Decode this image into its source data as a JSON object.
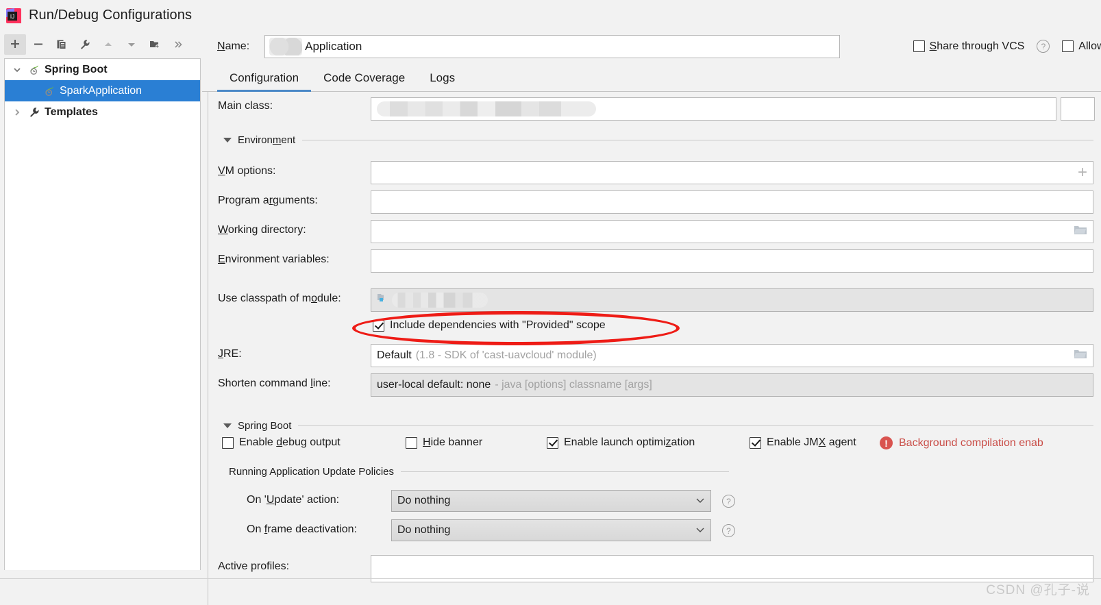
{
  "window": {
    "title": "Run/Debug Configurations",
    "app_icon": "intellij-idea-icon"
  },
  "toolbar": {
    "buttons": [
      {
        "name": "add-configuration-button",
        "icon": "plus-icon",
        "label": "+",
        "active": true
      },
      {
        "name": "remove-configuration-button",
        "icon": "minus-icon",
        "label": "−",
        "active": false
      },
      {
        "name": "copy-configuration-button",
        "icon": "copy-icon",
        "label": "",
        "active": false
      },
      {
        "name": "edit-templates-button",
        "icon": "wrench-icon",
        "label": "",
        "active": false
      },
      {
        "name": "move-up-button",
        "icon": "triangle-up-icon",
        "label": "",
        "active": false
      },
      {
        "name": "move-down-button",
        "icon": "triangle-down-icon",
        "label": "",
        "active": false
      },
      {
        "name": "new-folder-button",
        "icon": "folder-plus-icon",
        "label": "",
        "active": false
      },
      {
        "name": "more-options-button",
        "icon": "chevron-double-right-icon",
        "label": "»",
        "active": false
      }
    ]
  },
  "tree": {
    "items": [
      {
        "label": "Spring Boot",
        "twisty": "chevron-down-icon",
        "icon": "spring-boot-icon",
        "depth": 0,
        "selected": false
      },
      {
        "label": "SparkApplication",
        "twisty": "",
        "icon": "spring-boot-icon",
        "depth": 1,
        "selected": true
      },
      {
        "label": "Templates",
        "twisty": "chevron-right-icon",
        "icon": "wrench-icon",
        "depth": 0,
        "selected": false
      }
    ],
    "selected_color": "#2a7fd4"
  },
  "name_row": {
    "label": "Name:",
    "value": "Application",
    "blurred_prefix": true
  },
  "top_checkboxes": [
    {
      "label": "Share through VCS",
      "checked": false,
      "has_help": true
    },
    {
      "label": "Allow para",
      "checked": false,
      "has_help": false
    }
  ],
  "tabs": [
    {
      "label": "Configuration",
      "active": true
    },
    {
      "label": "Code Coverage",
      "active": false
    },
    {
      "label": "Logs",
      "active": false
    }
  ],
  "form": {
    "main_class": {
      "label": "Main class:",
      "value": "",
      "blurred": true
    },
    "environment_section": {
      "title": "Environment"
    },
    "vm_options": {
      "label": "VM options:",
      "value": "",
      "trailing_icon": "plus-icon"
    },
    "program_arguments": {
      "label": "Program arguments:",
      "value": "",
      "trailing_icon": ""
    },
    "working_directory": {
      "label": "Working directory:",
      "value": "",
      "trailing_icon": "folder-icon"
    },
    "environment_variables": {
      "label": "Environment variables:",
      "value": "",
      "trailing_icon": ""
    },
    "use_classpath": {
      "label": "Use classpath of module:",
      "value": "",
      "blurred": true
    },
    "include_provided": {
      "label": "Include dependencies with \"Provided\" scope",
      "checked": true,
      "highlighted": true,
      "highlight_color": "#ee1c16"
    },
    "jre": {
      "label": "JRE:",
      "value_strong": "Default",
      "value_muted": "(1.8 - SDK of 'cast-uavcloud' module)",
      "trailing_icon": "folder-icon"
    },
    "shorten_command_line": {
      "label": "Shorten command line:",
      "value_strong": "user-local default: none",
      "value_muted": "- java [options] classname [args]"
    }
  },
  "spring_boot_section": {
    "title": "Spring Boot",
    "checkboxes": [
      {
        "label": "Enable debug output",
        "checked": false
      },
      {
        "label": "Hide banner",
        "checked": false
      },
      {
        "label": "Enable launch optimization",
        "checked": true
      },
      {
        "label": "Enable JMX agent",
        "checked": true
      }
    ],
    "warning": {
      "icon": "error-circle-icon",
      "text": "Background compilation enab",
      "color": "#c94c46"
    }
  },
  "update_policies": {
    "title": "Running Application Update Policies",
    "rows": [
      {
        "label": "On 'Update' action:",
        "value": "Do nothing",
        "has_help": true
      },
      {
        "label": "On frame deactivation:",
        "value": "Do nothing",
        "has_help": true
      }
    ]
  },
  "active_profiles": {
    "label": "Active profiles:",
    "value": ""
  },
  "watermark": {
    "text": "CSDN @孔子-说"
  }
}
